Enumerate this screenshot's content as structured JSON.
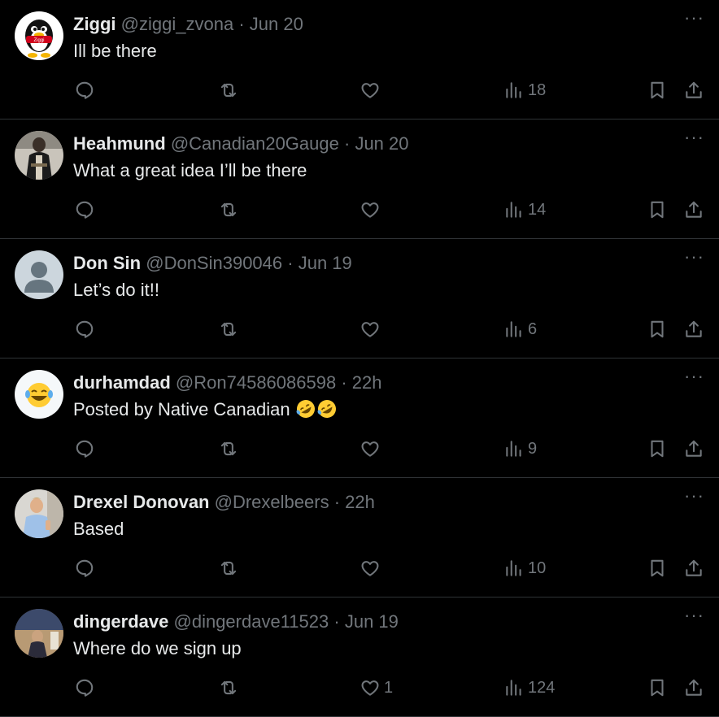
{
  "replies": [
    {
      "name": "Ziggi",
      "handle": "@ziggi_zvona",
      "sep": "·",
      "time": "Jun 20",
      "text": "Ill be there",
      "likes": "",
      "views": "18",
      "avatar_icon": "penguin-avatar-icon",
      "avatar_label": "Ziggi"
    },
    {
      "name": "Heahmund",
      "handle": "@Canadian20Gauge",
      "sep": "·",
      "time": "Jun 20",
      "text": "What a great idea I’ll be there",
      "likes": "",
      "views": "14",
      "avatar_icon": "soldier-avatar-icon"
    },
    {
      "name": "Don Sin",
      "handle": "@DonSin390046",
      "sep": "·",
      "time": "Jun 19",
      "text": "Let’s do it!!",
      "likes": "",
      "views": "6",
      "avatar_icon": "default-avatar-icon"
    },
    {
      "name": "durhamdad",
      "handle": "@Ron74586086598",
      "sep": "·",
      "time": "22h",
      "text": "Posted by Native Canadian",
      "text_emojis": "rolling-laughing-emoji x2",
      "likes": "",
      "views": "9",
      "avatar_icon": "laughing-emoji-avatar-icon"
    },
    {
      "name": "Drexel Donovan",
      "handle": "@Drexelbeers",
      "sep": "·",
      "time": "22h",
      "text": "Based",
      "likes": "",
      "views": "10",
      "avatar_icon": "photo-avatar-icon"
    },
    {
      "name": "dingerdave",
      "handle": "@dingerdave11523",
      "sep": "·",
      "time": "Jun 19",
      "text": "Where do we sign up",
      "likes": "1",
      "views": "124",
      "avatar_icon": "photo-avatar-icon"
    }
  ],
  "more_label": "···",
  "colors": {
    "background": "#000000",
    "primary_text": "#e7e9ea",
    "secondary_text": "#71767b",
    "divider": "#2f3336"
  }
}
